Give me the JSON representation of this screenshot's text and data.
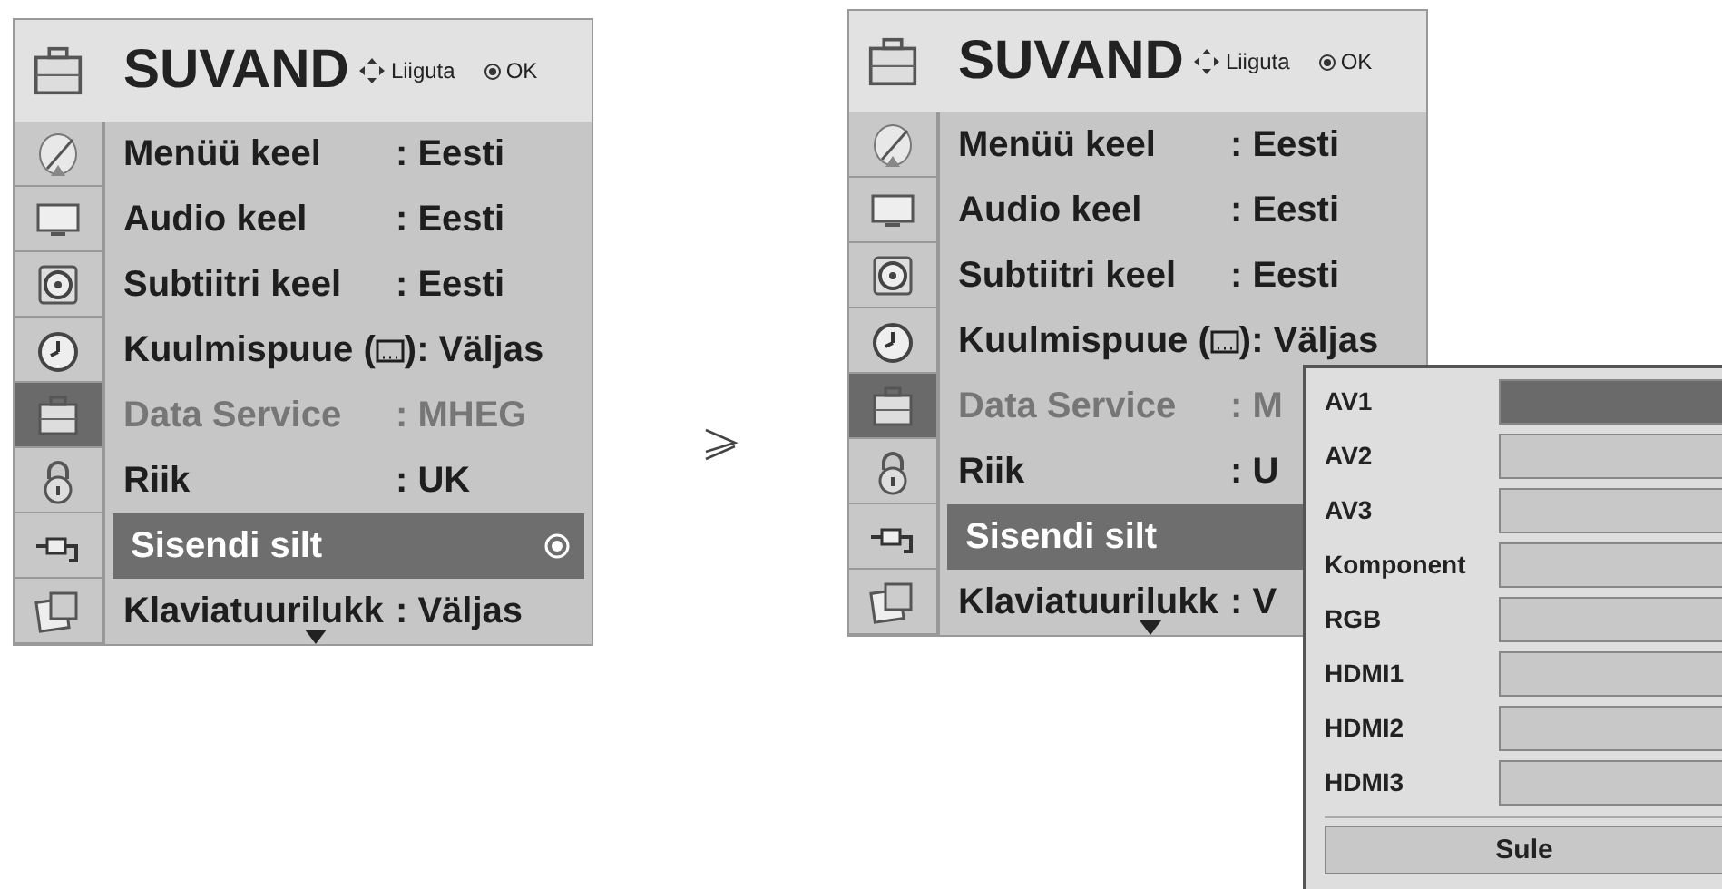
{
  "screens": [
    {
      "title": "SUVAND",
      "hints": [
        {
          "kind": "move",
          "label": "Liiguta"
        },
        {
          "kind": "ok",
          "label": "OK"
        }
      ],
      "sidebar": [
        {
          "kind": "satellite",
          "selected": false
        },
        {
          "kind": "tv",
          "selected": false
        },
        {
          "kind": "speaker",
          "selected": false
        },
        {
          "kind": "clock",
          "selected": false
        },
        {
          "kind": "toolbox",
          "selected": true
        },
        {
          "kind": "lock",
          "selected": false
        },
        {
          "kind": "plug",
          "selected": false
        },
        {
          "kind": "photos",
          "selected": false
        }
      ],
      "rows": [
        {
          "label": "Menüü keel",
          "value": ": Eesti",
          "disabled": false,
          "selected": false
        },
        {
          "label": "Audio keel",
          "value": ": Eesti",
          "disabled": false,
          "selected": false
        },
        {
          "label": "Subtiitri keel",
          "value": ": Eesti",
          "disabled": false,
          "selected": false
        },
        {
          "label": "Kuulmispuue (",
          "label_after_icon": ")",
          "value": ": Väljas",
          "disabled": false,
          "selected": false
        },
        {
          "label": "Data Service",
          "value": ": MHEG",
          "disabled": true,
          "selected": false
        },
        {
          "label": "Riik",
          "value": ": UK",
          "disabled": false,
          "selected": false
        },
        {
          "label": "Sisendi silt",
          "ok_mark": true,
          "disabled": false,
          "selected": true
        },
        {
          "label": "Klaviatuurilukk",
          "value": ": Väljas",
          "disabled": false,
          "selected": false
        }
      ],
      "more_below": true
    },
    {
      "title": "SUVAND",
      "hints": [
        {
          "kind": "move",
          "label": "Liiguta"
        },
        {
          "kind": "ok",
          "label": "OK"
        }
      ],
      "sidebar": [
        {
          "kind": "satellite",
          "selected": false
        },
        {
          "kind": "tv",
          "selected": false
        },
        {
          "kind": "speaker",
          "selected": false
        },
        {
          "kind": "clock",
          "selected": false
        },
        {
          "kind": "toolbox",
          "selected": true
        },
        {
          "kind": "lock",
          "selected": false
        },
        {
          "kind": "plug",
          "selected": false
        },
        {
          "kind": "photos",
          "selected": false
        }
      ],
      "rows": [
        {
          "label": "Menüü keel",
          "value": ": Eesti",
          "disabled": false,
          "selected": false
        },
        {
          "label": "Audio keel",
          "value": ": Eesti",
          "disabled": false,
          "selected": false
        },
        {
          "label": "Subtiitri keel",
          "value": ": Eesti",
          "disabled": false,
          "selected": false
        },
        {
          "label": "Kuulmispuue (",
          "label_after_icon": ")",
          "value": ": Väljas",
          "disabled": false,
          "selected": false
        },
        {
          "label": "Data Service",
          "value": ": M",
          "disabled": true,
          "selected": false
        },
        {
          "label": "Riik",
          "value": ": U",
          "disabled": false,
          "selected": false
        },
        {
          "label": "Sisendi silt",
          "disabled": false,
          "selected": true
        },
        {
          "label": "Klaviatuurilukk",
          "value": ": V",
          "disabled": false,
          "selected": false
        }
      ],
      "more_below": true
    }
  ],
  "popup": {
    "items": [
      {
        "label": "AV1",
        "selected": true
      },
      {
        "label": "AV2",
        "selected": false
      },
      {
        "label": "AV3",
        "selected": false
      },
      {
        "label": "Komponent",
        "selected": false
      },
      {
        "label": "RGB",
        "selected": false
      },
      {
        "label": "HDMI1",
        "selected": false
      },
      {
        "label": "HDMI2",
        "selected": false
      },
      {
        "label": "HDMI3",
        "selected": false
      }
    ],
    "close_button": "Sule"
  }
}
